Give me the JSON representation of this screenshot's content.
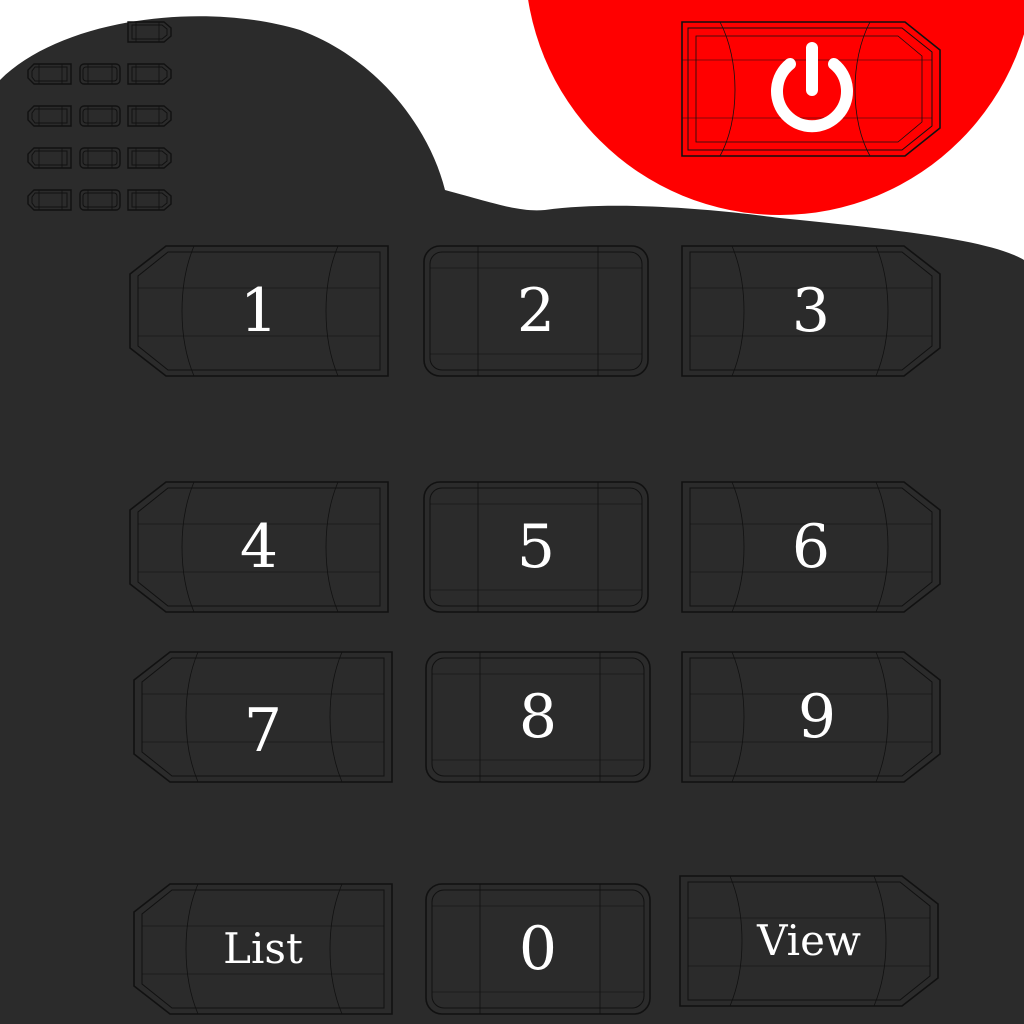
{
  "colors": {
    "remote_body": "#2b2b2b",
    "power_zone": "#ff0000",
    "background": "#ffffff",
    "label": "#ffffff",
    "key_outline": "#111111"
  },
  "power": {
    "icon": "power-icon"
  },
  "keypad": {
    "k1": "1",
    "k2": "2",
    "k3": "3",
    "k4": "4",
    "k5": "5",
    "k6": "6",
    "k7": "7",
    "k8": "8",
    "k9": "9",
    "list": "List",
    "k0": "0",
    "view": "View"
  }
}
